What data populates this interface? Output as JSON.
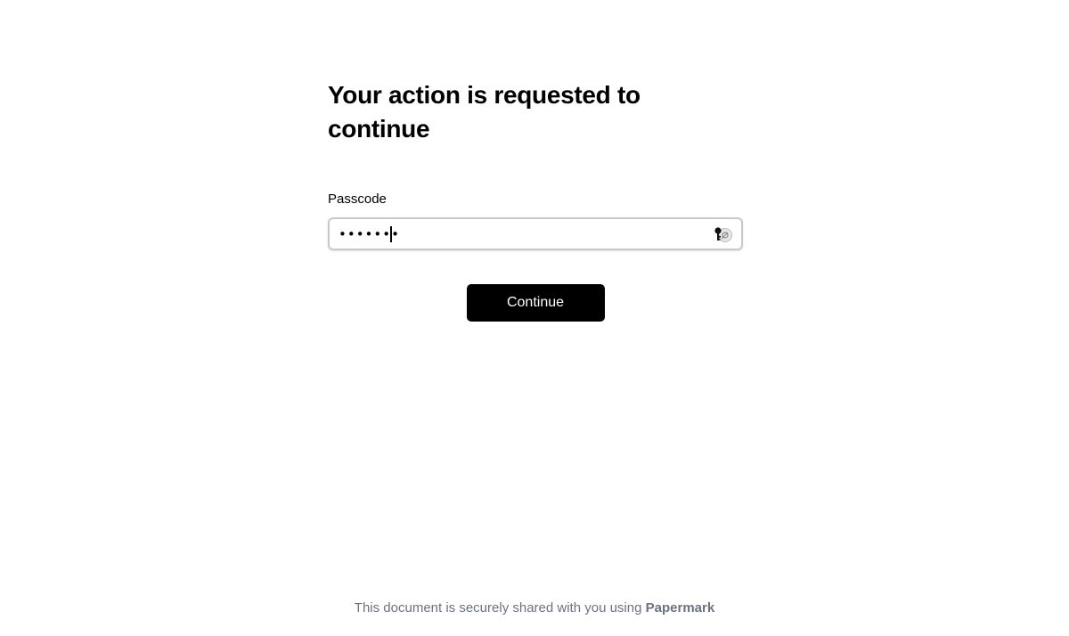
{
  "page": {
    "title": "Your action is requested to continue"
  },
  "form": {
    "passcode_label": "Passcode",
    "passcode_value": "•••••••",
    "password_manager_icon": "password-manager-key-icon",
    "continue_label": "Continue"
  },
  "footer": {
    "text": "This document is securely shared with you using ",
    "brand": "Papermark"
  },
  "colors": {
    "button_bg": "#000000",
    "button_text": "#ffffff",
    "input_border": "#c9c9c9",
    "footer_text": "#6b7280"
  }
}
